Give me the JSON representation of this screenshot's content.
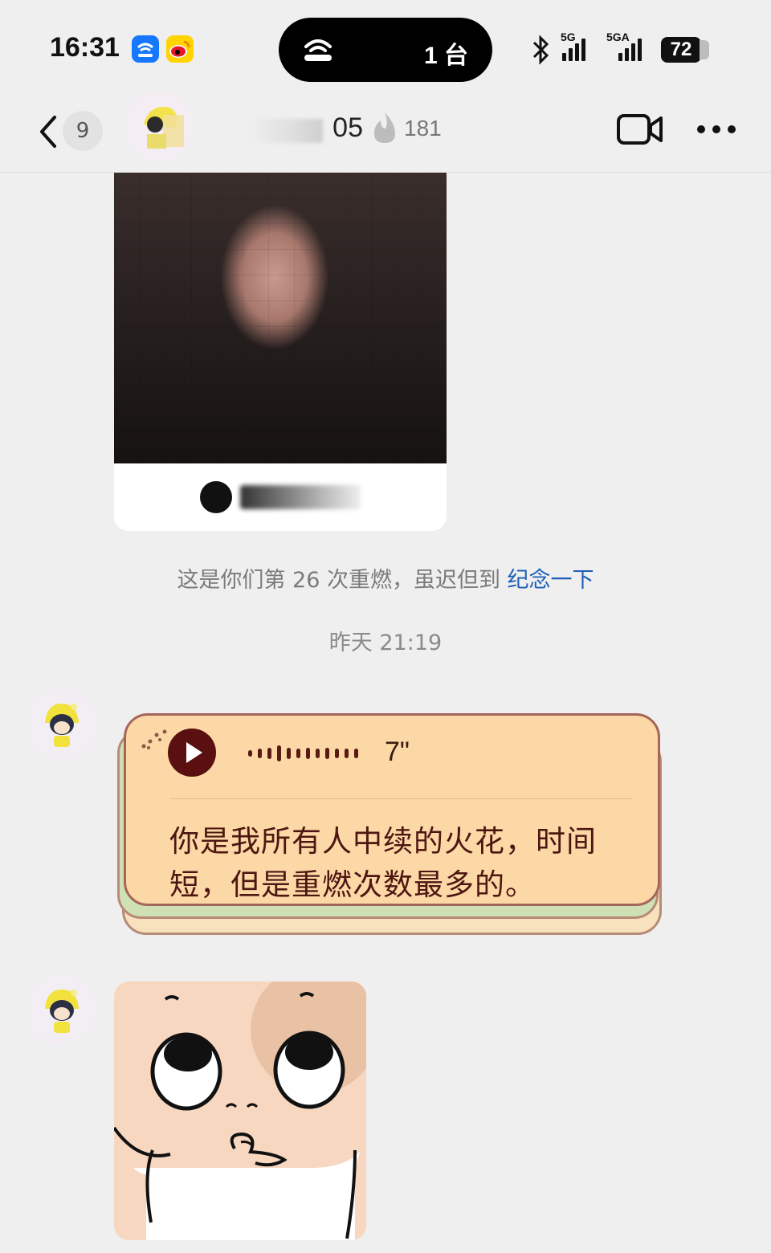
{
  "status_bar": {
    "time": "16:31",
    "island_text": "1 台",
    "signal_1": "5G",
    "signal_2": "5GA",
    "battery": "72",
    "icons": [
      "wifi-app-icon",
      "weibo-app-icon",
      "cast-icon",
      "bluetooth-icon",
      "signal-icon",
      "battery-icon"
    ]
  },
  "nav": {
    "unread_count": "9",
    "contact_name_suffix": "05",
    "streak_count": "181",
    "icons": [
      "back-arrow-icon",
      "flame-icon",
      "video-call-icon",
      "more-icon"
    ]
  },
  "chat": {
    "system_note": "这是你们第 26 次重燃，虽迟但到 ",
    "system_note_link": "纪念一下",
    "timestamp": "昨天 21:19",
    "voice_message": {
      "duration": "7\"",
      "transcript": "你是我所有人中续的火花，时间短，但是重燃次数最多的。"
    }
  },
  "colors": {
    "background": "#efefef",
    "link": "#1e5fb8",
    "bubble_fill": "#fbd8a5",
    "bubble_border": "#a5655b",
    "transcript_text": "#4e1612"
  }
}
